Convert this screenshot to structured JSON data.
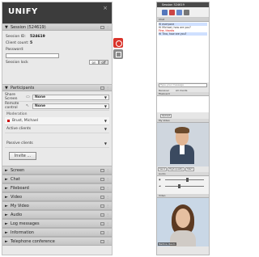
{
  "left": {
    "brand": "UNIFY",
    "close_glyph": "×",
    "session": {
      "header": "Session (524619)",
      "id_label": "Session ID:",
      "id_value": "524619",
      "count_label": "Client count:",
      "count_value": "5",
      "password_label": "Password:",
      "lock_label": "Session lock",
      "lock_on": "on",
      "lock_off": "off"
    },
    "participants": {
      "header": "Participants",
      "share_screen_label": "Share Screen",
      "share_screen_value": "None",
      "remote_control_label": "Remote control",
      "remote_control_value": "None",
      "moderation_label": "Moderation",
      "moderator_name": "Brust, Michael",
      "active_clients_label": "Active clients",
      "passive_clients_label": "Passive clients",
      "invite_label": "Invite ..."
    },
    "sections": [
      {
        "label": "Screen"
      },
      {
        "label": "Chat"
      },
      {
        "label": "Fileboard"
      },
      {
        "label": "Video"
      },
      {
        "label": "My Video"
      },
      {
        "label": "Audio"
      },
      {
        "label": "Log messages"
      },
      {
        "label": "Information"
      },
      {
        "label": "Telephone conference"
      }
    ]
  },
  "right": {
    "title": "Session 524619",
    "chat_header": "Chat",
    "chat_lines": [
      "Hi everyone",
      "Hi Michael, how are you?",
      "Fine, thanks",
      "Hi Tina, how are you?"
    ],
    "input_placeholder": "Type your message",
    "recipient_label": "Receiver",
    "recipient_value": "All clients",
    "fileboard_header": "Fileboard",
    "upload_label": "Upload",
    "myvideo_header": "My Video",
    "video_controls": [
      "Send",
      "High quality",
      "Start"
    ],
    "audio_header": "Audio",
    "video_header": "Video",
    "remote_name": "Martina, Raum"
  },
  "colors": {
    "accent_red": "#d9342b",
    "header_dark": "#3c3c3c"
  },
  "icons": {
    "screen_share": "screen-icon",
    "remote_control": "pointer-icon",
    "expand": "triangle-right-icon",
    "collapse": "triangle-down-icon"
  }
}
